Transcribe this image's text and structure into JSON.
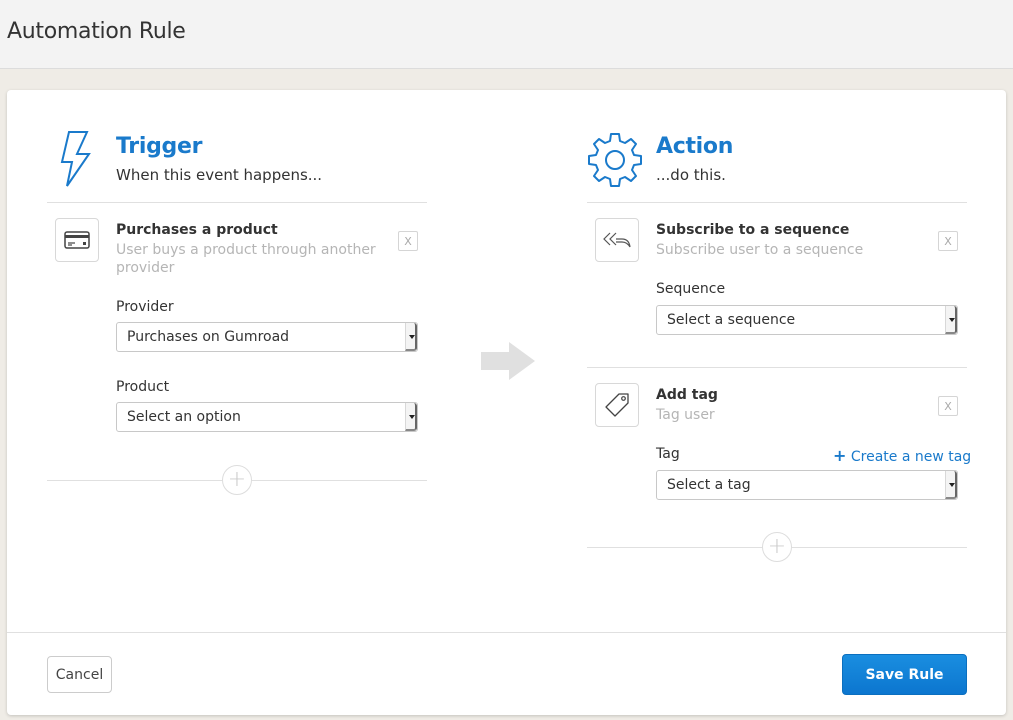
{
  "page": {
    "title": "Automation Rule"
  },
  "trigger": {
    "title": "Trigger",
    "subtitle": "When this event happens...",
    "icon": "lightning-icon",
    "item": {
      "icon": "credit-card-icon",
      "title": "Purchases a product",
      "description": "User buys a product through another provider",
      "remove_label": "X",
      "fields": [
        {
          "label": "Provider",
          "value": "Purchases on Gumroad"
        },
        {
          "label": "Product",
          "value": "Select an option"
        }
      ]
    },
    "add_label": "+"
  },
  "flow_arrow": "arrow-right-icon",
  "action": {
    "title": "Action",
    "subtitle": "...do this.",
    "icon": "gear-icon",
    "items": [
      {
        "icon": "reply-all-icon",
        "title": "Subscribe to a sequence",
        "description": "Subscribe user to a sequence",
        "remove_label": "X",
        "field": {
          "label": "Sequence",
          "value": "Select a sequence"
        }
      },
      {
        "icon": "tag-icon",
        "title": "Add tag",
        "description": "Tag user",
        "remove_label": "X",
        "field": {
          "label": "Tag",
          "value": "Select a tag"
        },
        "create_link": {
          "plus": "+",
          "label": " Create a new tag"
        }
      }
    ],
    "add_label": "+"
  },
  "footer": {
    "cancel_label": "Cancel",
    "save_label": "Save Rule"
  },
  "colors": {
    "accent": "#1a7acb",
    "save_button": "#0c76cf",
    "page_background": "#efece6"
  }
}
